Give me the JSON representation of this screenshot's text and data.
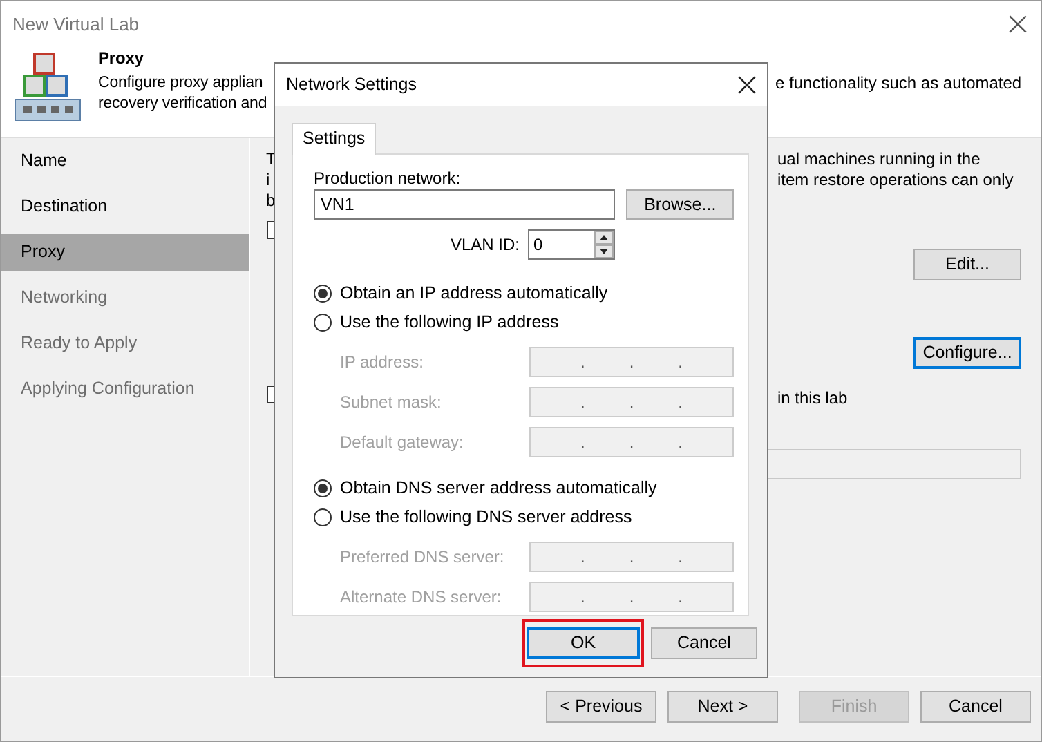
{
  "window": {
    "title": "New Virtual Lab"
  },
  "header": {
    "title": "Proxy",
    "lines": [
      "Configure proxy applian",
      "recovery verification and"
    ],
    "right_fragment": "e functionality such as automated"
  },
  "steps": [
    {
      "label": "Name",
      "selected": false,
      "enabled": true
    },
    {
      "label": "Destination",
      "selected": false,
      "enabled": true
    },
    {
      "label": "Proxy",
      "selected": true,
      "enabled": true
    },
    {
      "label": "Networking",
      "selected": false,
      "enabled": false
    },
    {
      "label": "Ready to Apply",
      "selected": false,
      "enabled": false
    },
    {
      "label": "Applying Configuration",
      "selected": false,
      "enabled": false
    }
  ],
  "page": {
    "left_fragments": [
      "T",
      "i",
      "b"
    ],
    "checkboxes": [
      {
        "checked": false
      },
      {
        "checked": false
      }
    ],
    "right_lines": [
      "ual machines running in the",
      "item restore operations can only"
    ],
    "edit_button": {
      "label": "Edit...",
      "focused": false
    },
    "configure_button": {
      "label": "Configure...",
      "focused": true
    },
    "lab_fragment": "in this lab"
  },
  "dialog": {
    "title": "Network Settings",
    "tabs": [
      {
        "label": "Settings",
        "selected": true
      }
    ],
    "production_network": {
      "label": "Production network:",
      "value": "VN1"
    },
    "browse_button": "Browse...",
    "vlan": {
      "label": "VLAN ID:",
      "value": "0"
    },
    "ip_options": [
      {
        "label": "Obtain an IP address automatically",
        "selected": true
      },
      {
        "label": "Use the following IP address",
        "selected": false
      }
    ],
    "ip_fields": [
      {
        "label": "IP address:",
        "disabled": true,
        "dots": [
          ".",
          ".",
          "."
        ]
      },
      {
        "label": "Subnet mask:",
        "disabled": true,
        "dots": [
          ".",
          ".",
          "."
        ]
      },
      {
        "label": "Default gateway:",
        "disabled": true,
        "dots": [
          ".",
          ".",
          "."
        ]
      }
    ],
    "dns_options": [
      {
        "label": "Obtain DNS server address automatically",
        "selected": true
      },
      {
        "label": "Use the following DNS server address",
        "selected": false
      }
    ],
    "dns_fields": [
      {
        "label": "Preferred DNS server:",
        "disabled": true,
        "dots": [
          ".",
          ".",
          "."
        ]
      },
      {
        "label": "Alternate DNS server:",
        "disabled": true,
        "dots": [
          ".",
          ".",
          "."
        ]
      }
    ],
    "buttons": [
      {
        "label": "OK",
        "focused": true,
        "highlighted": true
      },
      {
        "label": "Cancel",
        "focused": false,
        "highlighted": false
      }
    ]
  },
  "footer": {
    "buttons": [
      {
        "label": "< Previous",
        "disabled": false
      },
      {
        "label": "Next >",
        "disabled": false
      },
      {
        "label": "Finish",
        "disabled": true
      },
      {
        "label": "Cancel",
        "disabled": false
      }
    ]
  }
}
